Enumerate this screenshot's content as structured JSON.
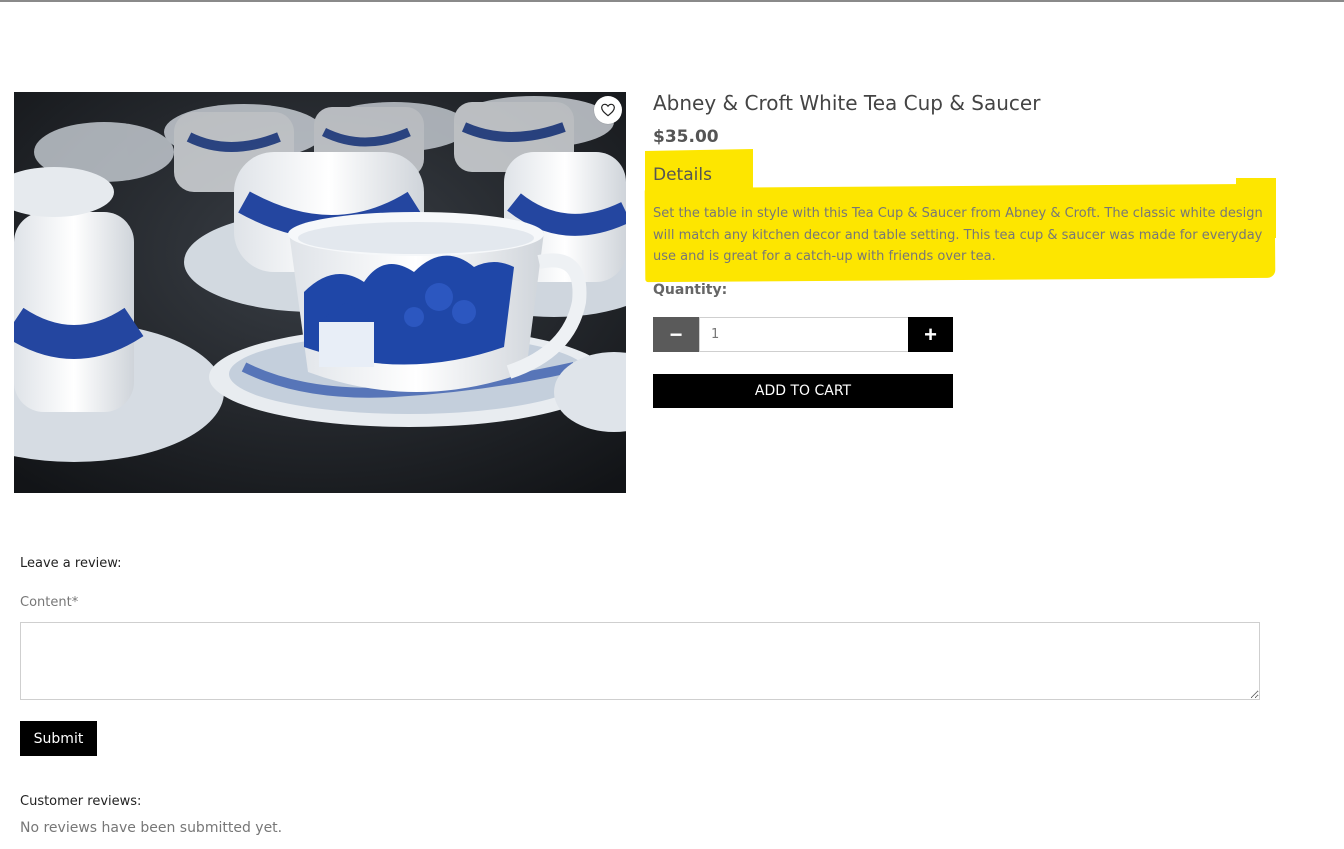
{
  "product": {
    "title": "Abney & Croft White Tea Cup & Saucer",
    "price": "$35.00",
    "details_heading": "Details",
    "description": "Set the table in style with this Tea Cup & Saucer from Abney & Croft. The classic white design will match any kitchen decor and table setting. This tea cup & saucer was made for everyday use and is great for a catch-up with friends over tea.",
    "image_icon": "heart-icon"
  },
  "quantity": {
    "label": "Quantity:",
    "value": "1",
    "minus_symbol": "−",
    "plus_symbol": "+"
  },
  "cart": {
    "add_label": "ADD TO CART"
  },
  "review_form": {
    "heading": "Leave a review:",
    "content_label": "Content*",
    "content_value": "",
    "submit_label": "Submit"
  },
  "reviews": {
    "heading": "Customer reviews:",
    "empty_text": "No reviews have been submitted yet."
  },
  "colors": {
    "highlight": "#fde600",
    "button_dark": "#000000",
    "minus_button": "#5a5a5a"
  }
}
